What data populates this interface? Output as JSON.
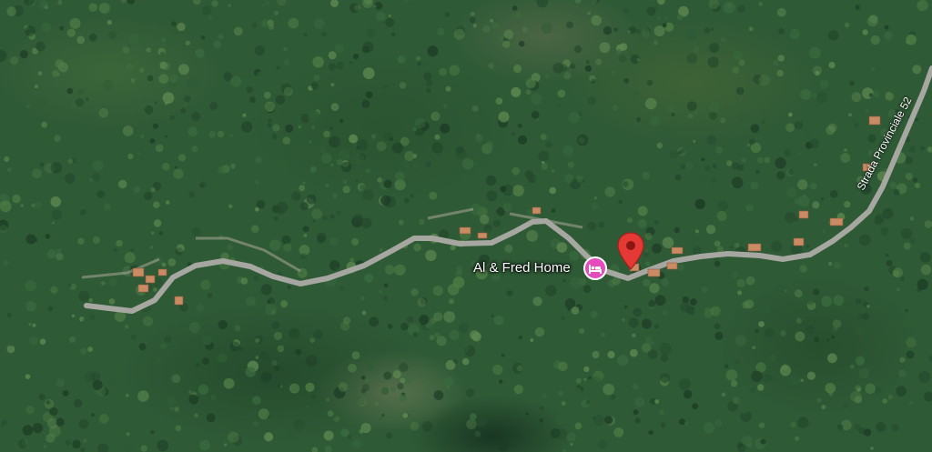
{
  "map": {
    "view": "satellite",
    "road_label": "Strada Provinciale 52",
    "poi": {
      "name": "Al & Fred Home",
      "category_icon": "hotel-bed-icon",
      "color": "#e64bbd"
    },
    "pin": {
      "icon": "location-pin-icon",
      "color": "#e53935"
    }
  }
}
